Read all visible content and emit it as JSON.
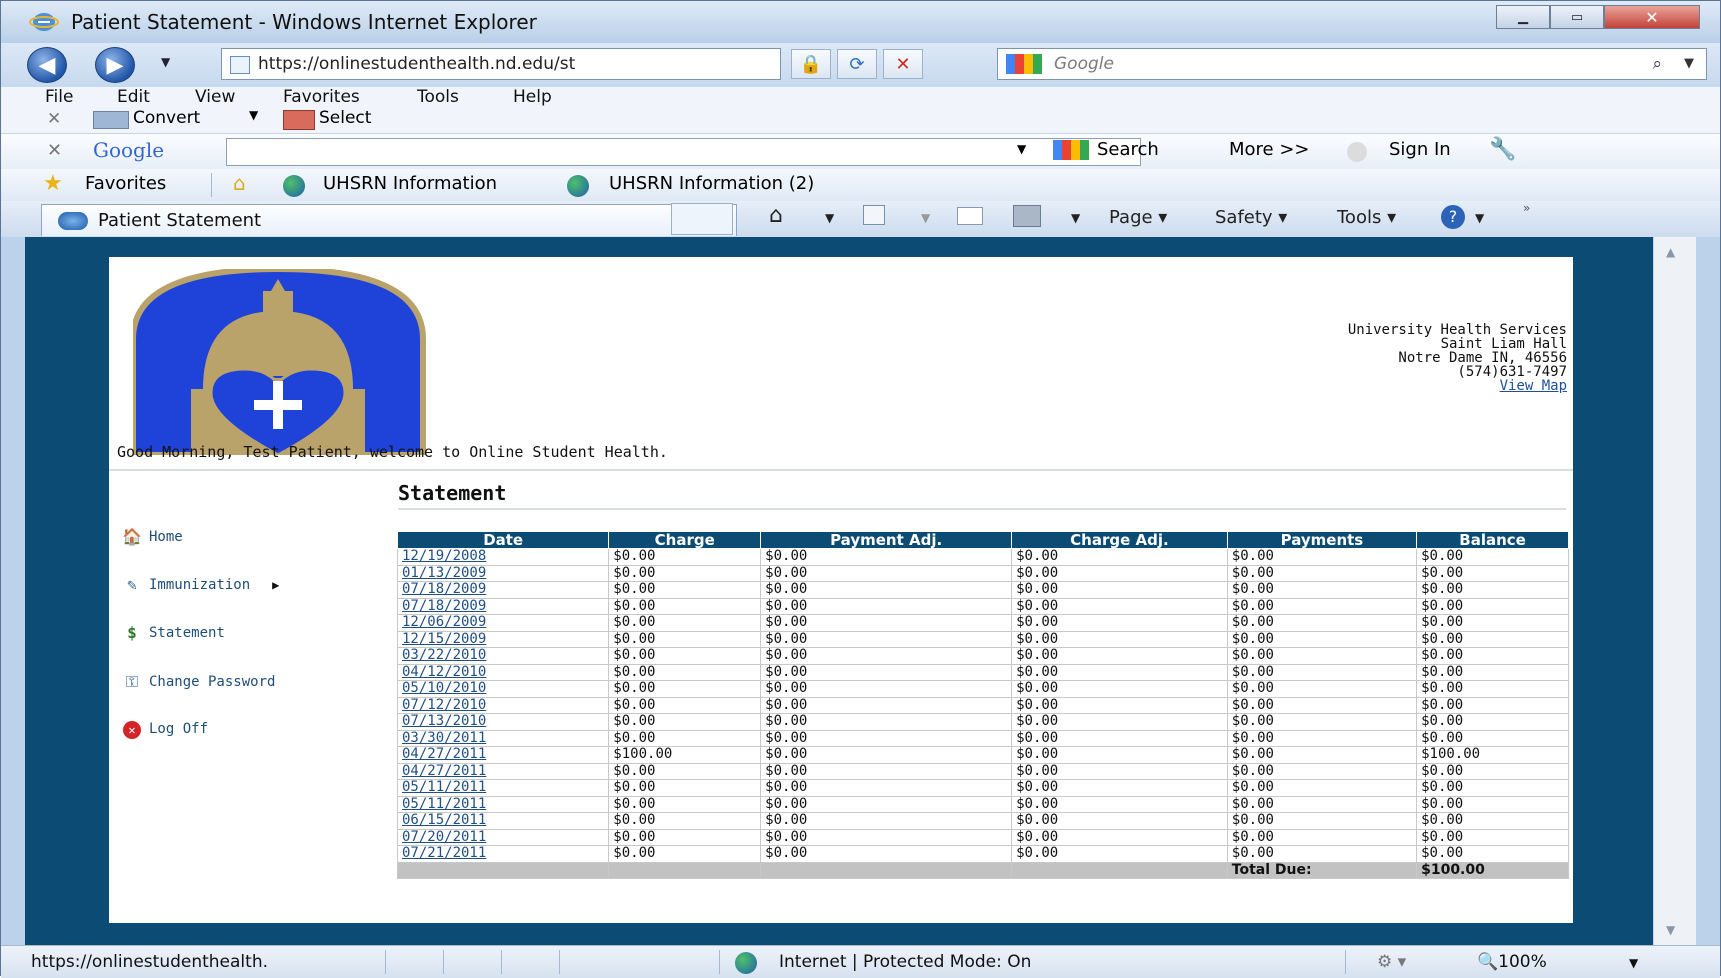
{
  "window": {
    "title": "Patient Statement - Windows Internet Explorer"
  },
  "address": {
    "url": "https://onlinestudenthealth.nd.edu/st",
    "search_placeholder": "Google"
  },
  "menu": [
    "File",
    "Edit",
    "View",
    "Favorites",
    "Tools",
    "Help"
  ],
  "convert_bar": {
    "convert": "Convert",
    "select": "Select"
  },
  "google_bar": {
    "logo": "Google",
    "search": "Search",
    "more": "More >>",
    "sign_in": "Sign In"
  },
  "favorites_bar": {
    "favorites": "Favorites",
    "link1": "UHSRN Information",
    "link2": "UHSRN Information (2)"
  },
  "tab": {
    "title": "Patient Statement"
  },
  "commands": {
    "page": "Page",
    "safety": "Safety",
    "tools": "Tools"
  },
  "header": {
    "address_lines": [
      "University Health Services",
      "Saint Liam Hall",
      "Notre Dame IN, 46556",
      "(574)631-7497"
    ],
    "map_link": "View Map",
    "welcome": "Good Morning, Test Patient, welcome to Online Student Health."
  },
  "nav": {
    "home": "Home",
    "immunization": "Immunization",
    "statement": "Statement",
    "change_password": "Change Password",
    "log_off": "Log Off"
  },
  "statement": {
    "title": "Statement",
    "columns": [
      "Date",
      "Charge",
      "Payment Adj.",
      "Charge Adj.",
      "Payments",
      "Balance"
    ],
    "rows": [
      [
        "12/19/2008",
        "$0.00",
        "$0.00",
        "$0.00",
        "$0.00",
        "$0.00"
      ],
      [
        "01/13/2009",
        "$0.00",
        "$0.00",
        "$0.00",
        "$0.00",
        "$0.00"
      ],
      [
        "07/18/2009",
        "$0.00",
        "$0.00",
        "$0.00",
        "$0.00",
        "$0.00"
      ],
      [
        "07/18/2009",
        "$0.00",
        "$0.00",
        "$0.00",
        "$0.00",
        "$0.00"
      ],
      [
        "12/06/2009",
        "$0.00",
        "$0.00",
        "$0.00",
        "$0.00",
        "$0.00"
      ],
      [
        "12/15/2009",
        "$0.00",
        "$0.00",
        "$0.00",
        "$0.00",
        "$0.00"
      ],
      [
        "03/22/2010",
        "$0.00",
        "$0.00",
        "$0.00",
        "$0.00",
        "$0.00"
      ],
      [
        "04/12/2010",
        "$0.00",
        "$0.00",
        "$0.00",
        "$0.00",
        "$0.00"
      ],
      [
        "05/10/2010",
        "$0.00",
        "$0.00",
        "$0.00",
        "$0.00",
        "$0.00"
      ],
      [
        "07/12/2010",
        "$0.00",
        "$0.00",
        "$0.00",
        "$0.00",
        "$0.00"
      ],
      [
        "07/13/2010",
        "$0.00",
        "$0.00",
        "$0.00",
        "$0.00",
        "$0.00"
      ],
      [
        "03/30/2011",
        "$0.00",
        "$0.00",
        "$0.00",
        "$0.00",
        "$0.00"
      ],
      [
        "04/27/2011",
        "$100.00",
        "$0.00",
        "$0.00",
        "$0.00",
        "$100.00"
      ],
      [
        "04/27/2011",
        "$0.00",
        "$0.00",
        "$0.00",
        "$0.00",
        "$0.00"
      ],
      [
        "05/11/2011",
        "$0.00",
        "$0.00",
        "$0.00",
        "$0.00",
        "$0.00"
      ],
      [
        "05/11/2011",
        "$0.00",
        "$0.00",
        "$0.00",
        "$0.00",
        "$0.00"
      ],
      [
        "06/15/2011",
        "$0.00",
        "$0.00",
        "$0.00",
        "$0.00",
        "$0.00"
      ],
      [
        "07/20/2011",
        "$0.00",
        "$0.00",
        "$0.00",
        "$0.00",
        "$0.00"
      ],
      [
        "07/21/2011",
        "$0.00",
        "$0.00",
        "$0.00",
        "$0.00",
        "$0.00"
      ]
    ],
    "total_label": "Total Due:",
    "total_value": "$100.00"
  },
  "status": {
    "url": "https://onlinestudenthealth.",
    "zone": "Internet | Protected Mode: On",
    "zoom": "100%"
  },
  "colors": {
    "page_bg": "#0c4b73",
    "header_bg": "#0c4b73",
    "crest_blue": "#1f43d8",
    "crest_gold": "#b9a36a",
    "link": "#1f4f86"
  }
}
